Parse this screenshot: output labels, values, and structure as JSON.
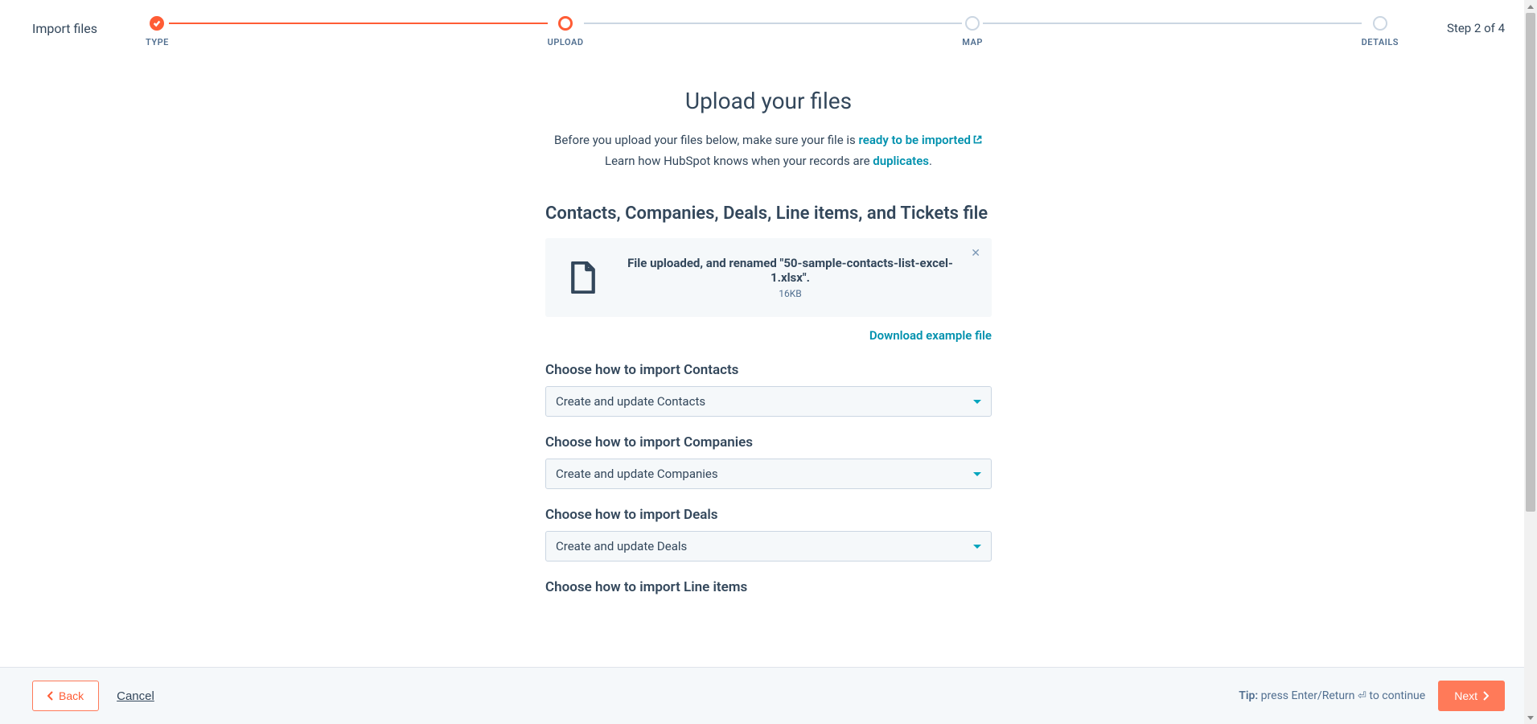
{
  "header": {
    "title": "Import files",
    "step_indicator": "Step 2 of 4"
  },
  "progress": {
    "steps": [
      {
        "label": "TYPE"
      },
      {
        "label": "UPLOAD"
      },
      {
        "label": "MAP"
      },
      {
        "label": "DETAILS"
      }
    ]
  },
  "main": {
    "heading": "Upload your files",
    "intro_before": "Before you upload your files below, make sure your file is ",
    "intro_link1": "ready to be imported",
    "intro_line2_before": "Learn how HubSpot knows when your records are ",
    "intro_link2": "duplicates",
    "section_heading": "Contacts, Companies, Deals, Line items, and Tickets file",
    "file": {
      "status": "File uploaded, and renamed \"50-sample-contacts-list-excel-1.xlsx\".",
      "size": "16KB"
    },
    "download_link": "Download example file",
    "fields": [
      {
        "label": "Choose how to import Contacts",
        "value": "Create and update Contacts"
      },
      {
        "label": "Choose how to import Companies",
        "value": "Create and update Companies"
      },
      {
        "label": "Choose how to import Deals",
        "value": "Create and update Deals"
      },
      {
        "label": "Choose how to import Line items",
        "value": ""
      }
    ]
  },
  "footer": {
    "back": "Back",
    "cancel": "Cancel",
    "tip_label": "Tip:",
    "tip_text": " press Enter/Return ",
    "tip_suffix": " to continue",
    "next": "Next"
  }
}
